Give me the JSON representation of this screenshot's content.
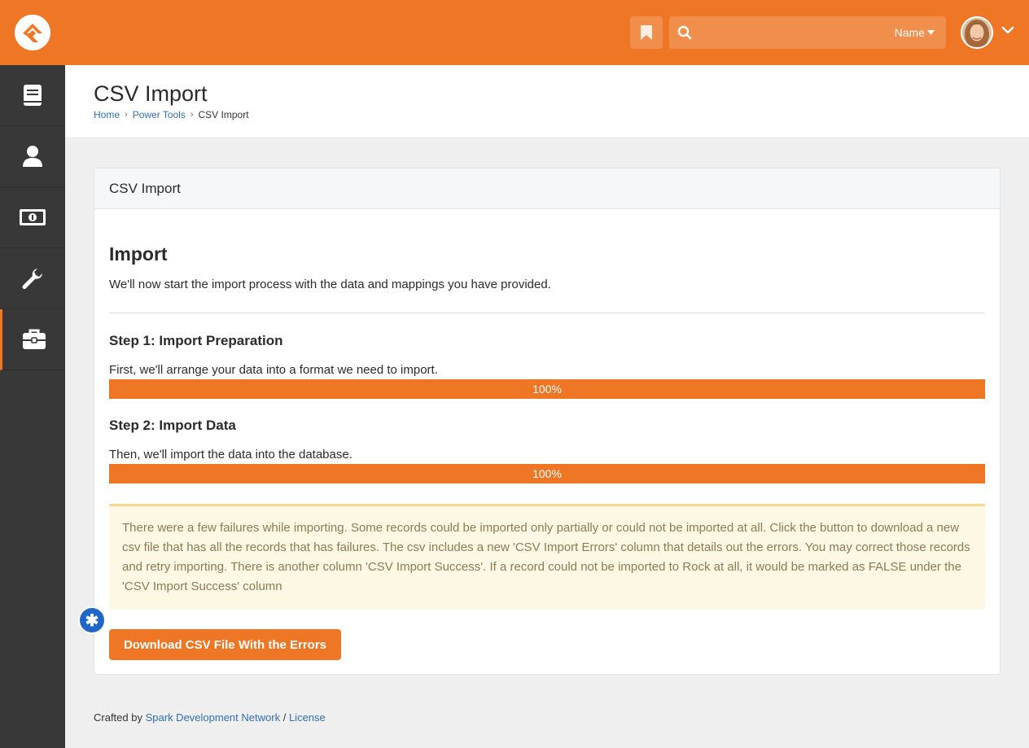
{
  "colors": {
    "brand": "#ee7625",
    "sidebar": "#383838",
    "link": "#2f6fb5",
    "warning_bg": "#fdf8e4",
    "warning_text": "#8c7b54"
  },
  "topbar": {
    "search": {
      "value": "",
      "placeholder": "",
      "scope_label": "Name"
    },
    "icons": [
      "logo-icon",
      "bookmark-icon",
      "search-icon",
      "caret-down-icon",
      "chevron-down-icon"
    ]
  },
  "sidebar": {
    "items": [
      {
        "name": "book-icon"
      },
      {
        "name": "person-icon"
      },
      {
        "name": "money-icon"
      },
      {
        "name": "wrench-icon"
      },
      {
        "name": "briefcase-icon",
        "active": true
      }
    ]
  },
  "header": {
    "title": "CSV Import",
    "breadcrumb": [
      "Home",
      "Power Tools",
      "CSV Import"
    ]
  },
  "panel": {
    "heading": "CSV Import",
    "import_title": "Import",
    "import_desc": "We'll now start the import process with the data and mappings you have provided.",
    "steps": [
      {
        "title": "Step 1: Import Preparation",
        "desc": "First, we'll arrange your data into a format we need to import.",
        "progress": 100,
        "progress_label": "100%"
      },
      {
        "title": "Step 2: Import Data",
        "desc": "Then, we'll import the data into the database.",
        "progress": 100,
        "progress_label": "100%"
      }
    ],
    "warning": "There were a few failures while importing. Some records could be imported only partially or could not be imported at all. Click the button to download a new csv file that has all the records that has failures. The csv includes a new 'CSV Import Errors' column that details out the errors. You may correct those records and retry importing. There is another column 'CSV Import Success'. If a record could not be imported to Rock at all, it would be marked as FALSE under the 'CSV Import Success' column",
    "download_label": "Download CSV File With the Errors"
  },
  "footer": {
    "prefix": "Crafted by",
    "link1": "Spark Development Network",
    "sep": "/",
    "link2": "License"
  }
}
